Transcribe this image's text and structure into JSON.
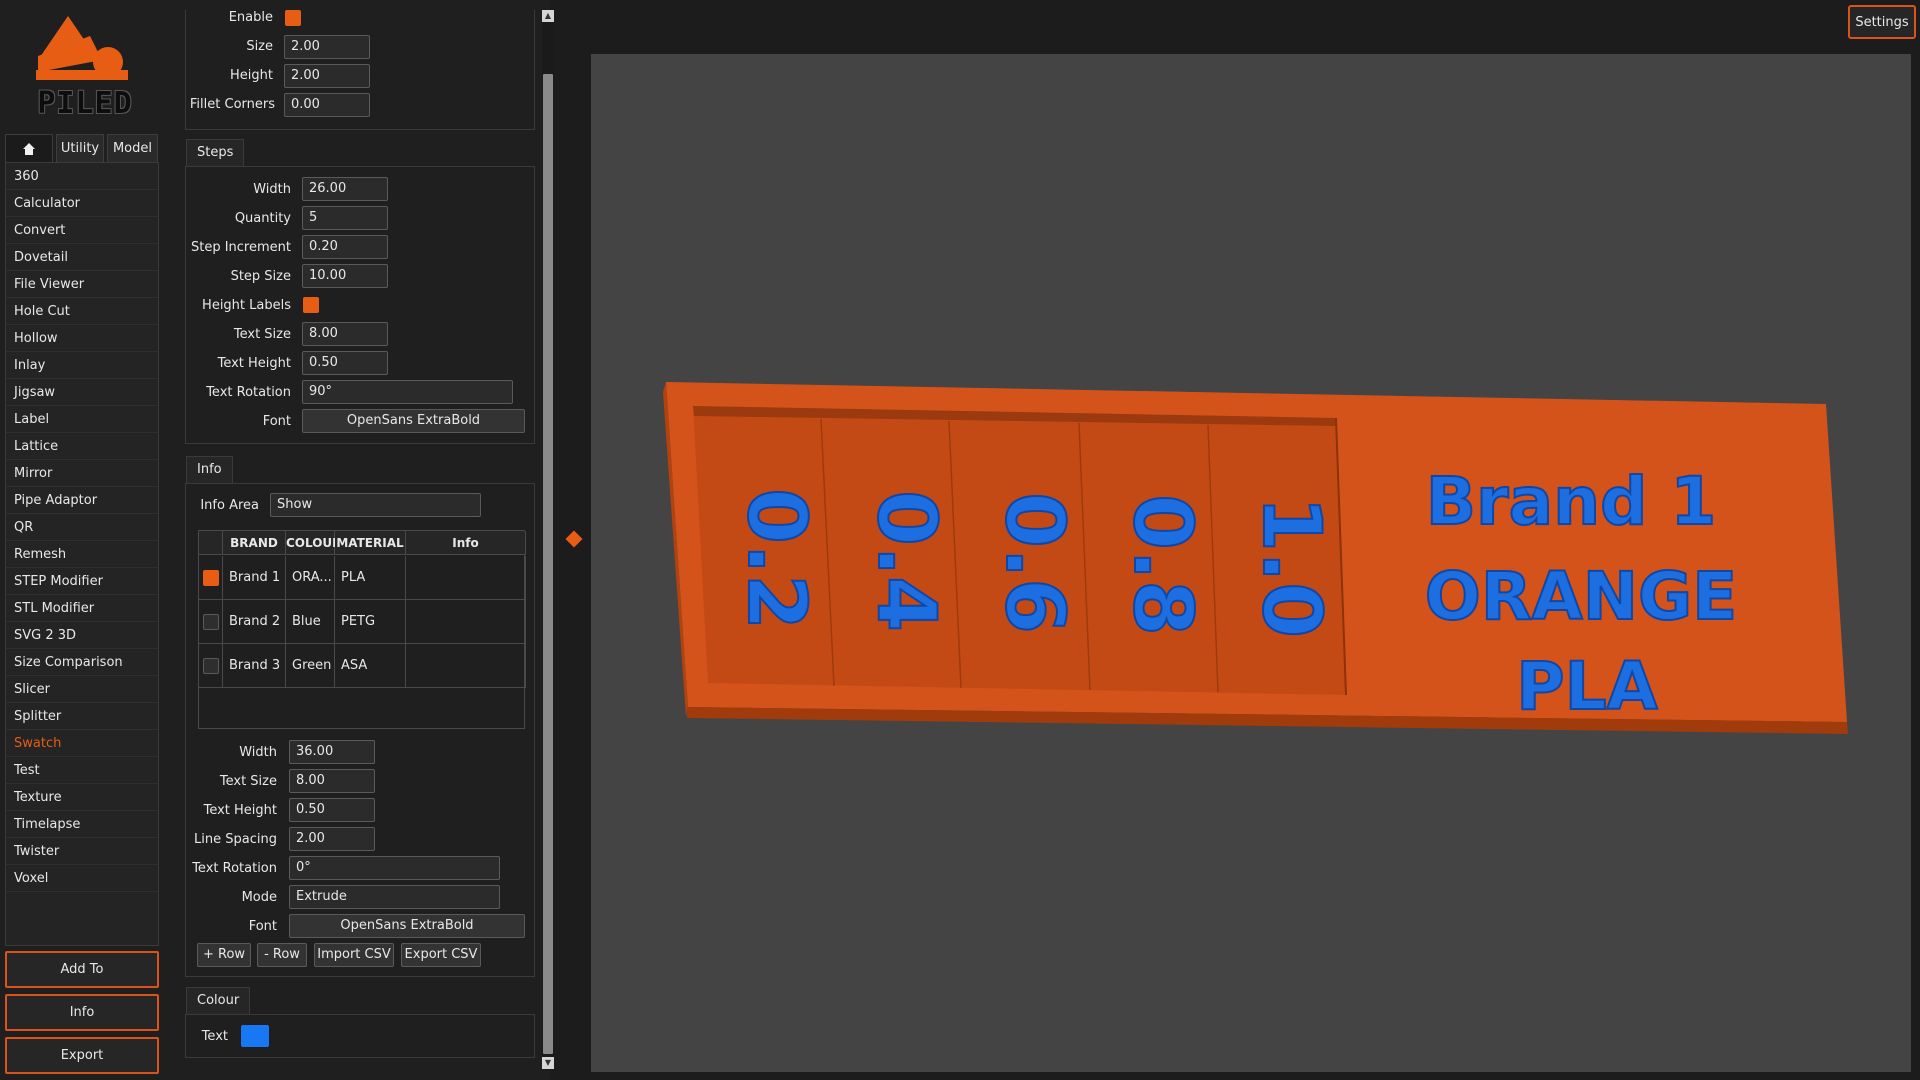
{
  "app": {
    "logo_text": "PILED",
    "colors": {
      "accent": "#e85d14",
      "model_base": "#d9531b",
      "model_text": "#1d6ee0",
      "viewport_bg": "#444444",
      "text_swatch": "#1877f2"
    }
  },
  "sidebar": {
    "tabs": [
      {
        "icon": "home-icon",
        "label": ""
      },
      {
        "label": "Utility"
      },
      {
        "label": "Model"
      }
    ],
    "items": [
      "360",
      "Calculator",
      "Convert",
      "Dovetail",
      "File Viewer",
      "Hole Cut",
      "Hollow",
      "Inlay",
      "Jigsaw",
      "Label",
      "Lattice",
      "Mirror",
      "Pipe Adaptor",
      "QR",
      "Remesh",
      "STEP Modifier",
      "STL Modifier",
      "SVG 2 3D",
      "Size Comparison",
      "Slicer",
      "Splitter",
      "Swatch",
      "Test",
      "Texture",
      "Timelapse",
      "Twister",
      "Voxel"
    ],
    "active_item": "Swatch",
    "buttons": {
      "add_to": "Add To",
      "info": "Info",
      "export": "Export"
    }
  },
  "panel": {
    "top": {
      "enable_label": "Enable",
      "enable_checked": true,
      "size_label": "Size",
      "size_value": "2.00",
      "height_label": "Height",
      "height_value": "2.00",
      "fillet_label": "Fillet Corners",
      "fillet_value": "0.00"
    },
    "steps": {
      "title": "Steps",
      "width_label": "Width",
      "width_value": "26.00",
      "quantity_label": "Quantity",
      "quantity_value": "5",
      "step_increment_label": "Step Increment",
      "step_increment_value": "0.20",
      "step_size_label": "Step Size",
      "step_size_value": "10.00",
      "height_labels_label": "Height Labels",
      "height_labels_checked": true,
      "text_size_label": "Text Size",
      "text_size_value": "8.00",
      "text_height_label": "Text Height",
      "text_height_value": "0.50",
      "text_rotation_label": "Text Rotation",
      "text_rotation_value": "90°",
      "font_label": "Font",
      "font_value": "OpenSans ExtraBold"
    },
    "info": {
      "title": "Info",
      "area_label": "Info Area",
      "area_value": "Show",
      "table": {
        "headers": [
          "",
          "BRAND",
          "COLOUR",
          "MATERIAL",
          "Info"
        ],
        "rows": [
          {
            "checked": true,
            "brand": "Brand 1",
            "colour": "ORA...",
            "material": "PLA",
            "info": ""
          },
          {
            "checked": false,
            "brand": "Brand 2",
            "colour": "Blue",
            "material": "PETG",
            "info": ""
          },
          {
            "checked": false,
            "brand": "Brand 3",
            "colour": "Green",
            "material": "ASA",
            "info": ""
          }
        ]
      },
      "width_label": "Width",
      "width_value": "36.00",
      "text_size_label": "Text Size",
      "text_size_value": "8.00",
      "text_height_label": "Text Height",
      "text_height_value": "0.50",
      "line_spacing_label": "Line Spacing",
      "line_spacing_value": "2.00",
      "text_rotation_label": "Text Rotation",
      "text_rotation_value": "0°",
      "mode_label": "Mode",
      "mode_value": "Extrude",
      "font_label": "Font",
      "font_value": "OpenSans ExtraBold",
      "buttons": {
        "add_row": "+ Row",
        "remove_row": "- Row",
        "import_csv": "Import CSV",
        "export_csv": "Export CSV"
      }
    },
    "colour": {
      "title": "Colour",
      "text_label": "Text"
    }
  },
  "viewport": {
    "settings_label": "Settings",
    "step_labels": [
      "0.2",
      "0.4",
      "0.6",
      "0.8",
      "1.0"
    ],
    "info_lines": [
      "Brand 1",
      "ORANGE",
      "PLA"
    ]
  }
}
